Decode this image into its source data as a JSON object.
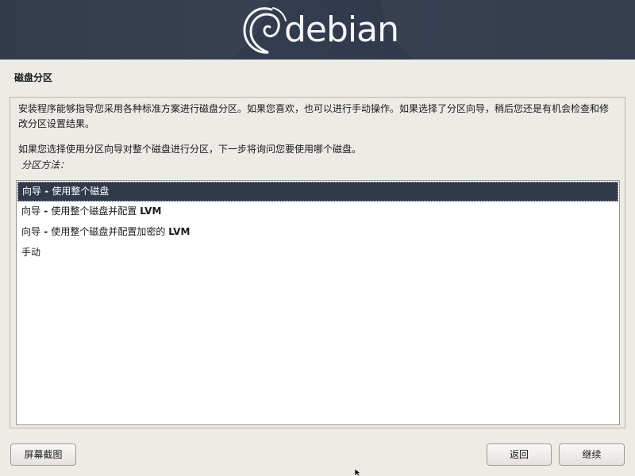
{
  "banner": {
    "brand": "debian"
  },
  "section": {
    "title": "磁盘分区"
  },
  "description": {
    "paragraph1": "安装程序能够指导您采用各种标准方案进行磁盘分区。如果您喜欢，也可以进行手动操作。如果选择了分区向导，稍后您还是有机会检查和修改分区设置结果。",
    "paragraph2": "如果您选择使用分区向导对整个磁盘进行分区，下一步将询问您要使用哪个磁盘。",
    "method_label": "分区方法："
  },
  "methods": [
    {
      "prefix": "向导",
      "sep": " - ",
      "text": "使用整个磁盘",
      "suffix": "",
      "selected": true
    },
    {
      "prefix": "向导",
      "sep": " - ",
      "text": "使用整个磁盘并配置 ",
      "suffix": "LVM",
      "selected": false
    },
    {
      "prefix": "向导",
      "sep": " - ",
      "text": "使用整个磁盘并配置加密的 ",
      "suffix": "LVM",
      "selected": false
    },
    {
      "prefix": "手动",
      "sep": "",
      "text": "",
      "suffix": "",
      "selected": false
    }
  ],
  "buttons": {
    "screenshot": "屏幕截图",
    "back": "返回",
    "continue": "继续"
  },
  "colors": {
    "banner": "#313a4b",
    "selected_row": "#313a4b",
    "background": "#edebe6"
  },
  "icons": {
    "logo": "debian-swirl-icon",
    "pointer": "mouse-pointer-icon"
  }
}
